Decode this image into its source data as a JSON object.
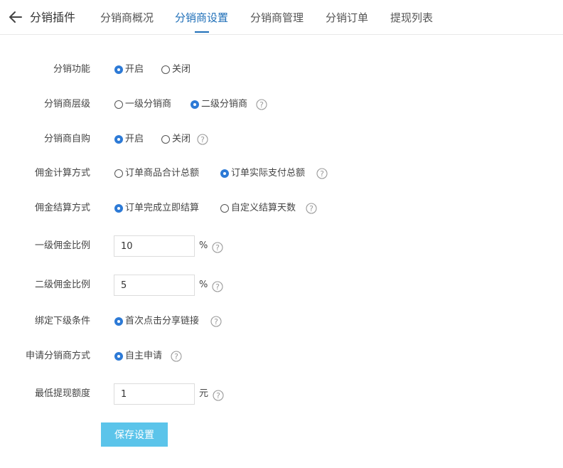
{
  "header": {
    "title": "分销插件",
    "tabs": [
      {
        "label": "分销商概况"
      },
      {
        "label": "分销商设置",
        "active": true
      },
      {
        "label": "分销商管理"
      },
      {
        "label": "分销订单"
      },
      {
        "label": "提现列表"
      }
    ],
    "accent_color": "#1f6fb8"
  },
  "form": {
    "function": {
      "label": "分销功能",
      "options": [
        "开启",
        "关闭"
      ],
      "selected": "开启"
    },
    "level": {
      "label": "分销商层级",
      "options": [
        "一级分销商",
        "二级分销商"
      ],
      "selected": "二级分销商",
      "help": "help-icon"
    },
    "self_purchase": {
      "label": "分销商自购",
      "options": [
        "开启",
        "关闭"
      ],
      "selected": "开启",
      "help": "help-icon"
    },
    "commission_calc": {
      "label": "佣金计算方式",
      "options": [
        "订单商品合计总额",
        "订单实际支付总额"
      ],
      "selected": "订单实际支付总额",
      "help": "help-icon"
    },
    "commission_settle": {
      "label": "佣金结算方式",
      "options": [
        "订单完成立即结算",
        "自定义结算天数"
      ],
      "selected": "订单完成立即结算",
      "help": "help-icon"
    },
    "level1_ratio": {
      "label": "一级佣金比例",
      "value": "10",
      "unit": "%",
      "help": "help-icon"
    },
    "level2_ratio": {
      "label": "二级佣金比例",
      "value": "5",
      "unit": "%",
      "help": "help-icon"
    },
    "bind_condition": {
      "label": "绑定下级条件",
      "options": [
        "首次点击分享链接"
      ],
      "selected": "首次点击分享链接",
      "help": "help-icon"
    },
    "apply_method": {
      "label": "申请分销商方式",
      "options": [
        "自主申请"
      ],
      "selected": "自主申请",
      "help": "help-icon"
    },
    "min_withdraw": {
      "label": "最低提现额度",
      "value": "1",
      "unit": "元",
      "help": "help-icon"
    }
  },
  "save_button": {
    "label": "保存设置",
    "color": "#5bc4ea"
  }
}
